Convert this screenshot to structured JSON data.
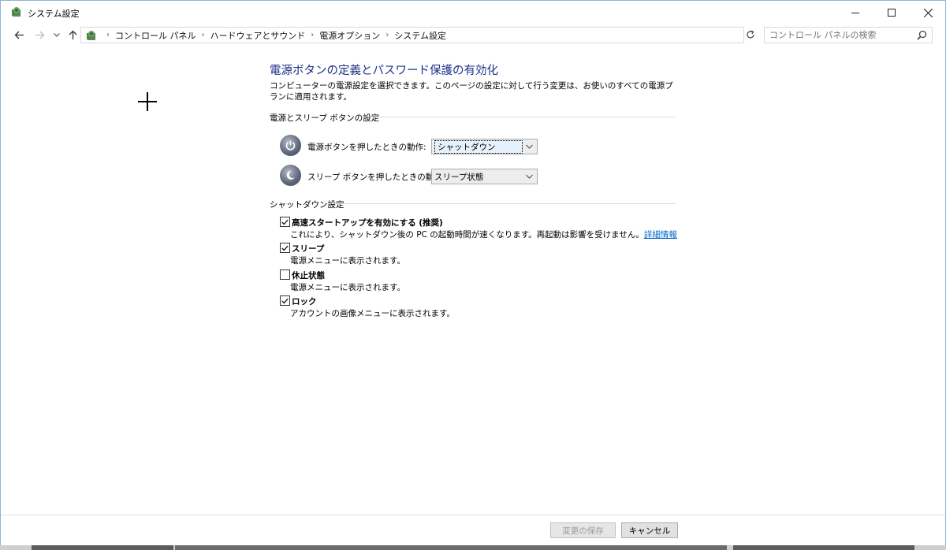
{
  "window": {
    "title": "システム設定"
  },
  "nav": {
    "breadcrumbs": [
      "コントロール パネル",
      "ハードウェアとサウンド",
      "電源オプション",
      "システム設定"
    ],
    "search_placeholder": "コントロール パネルの検索"
  },
  "page": {
    "title": "電源ボタンの定義とパスワード保護の有効化",
    "description": "コンピューターの電源設定を選択できます。このページの設定に対して行う変更は、お使いのすべての電源プランに適用されます。"
  },
  "power_section": {
    "heading": "電源とスリープ ボタンの設定",
    "power_button": {
      "label": "電源ボタンを押したときの動作:",
      "value": "シャットダウン"
    },
    "sleep_button": {
      "label": "スリープ ボタンを押したときの動作:",
      "value": "スリープ状態"
    }
  },
  "shutdown_section": {
    "heading": "シャットダウン設定",
    "fast_startup": {
      "label": "高速スタートアップを有効にする (推奨)",
      "description": "これにより、シャットダウン後の PC の起動時間が速くなります。再起動は影響を受けません。",
      "link": "詳細情報",
      "checked": true
    },
    "sleep": {
      "label": "スリープ",
      "description": "電源メニューに表示されます。",
      "checked": true
    },
    "hibernate": {
      "label": "休止状態",
      "description": "電源メニューに表示されます。",
      "checked": false
    },
    "lock": {
      "label": "ロック",
      "description": "アカウントの画像メニューに表示されます。",
      "checked": true
    }
  },
  "footer": {
    "save_label": "変更の保存",
    "cancel_label": "キャンセル"
  },
  "colors": {
    "title_blue": "#1e3287",
    "link_blue": "#0066cc"
  }
}
